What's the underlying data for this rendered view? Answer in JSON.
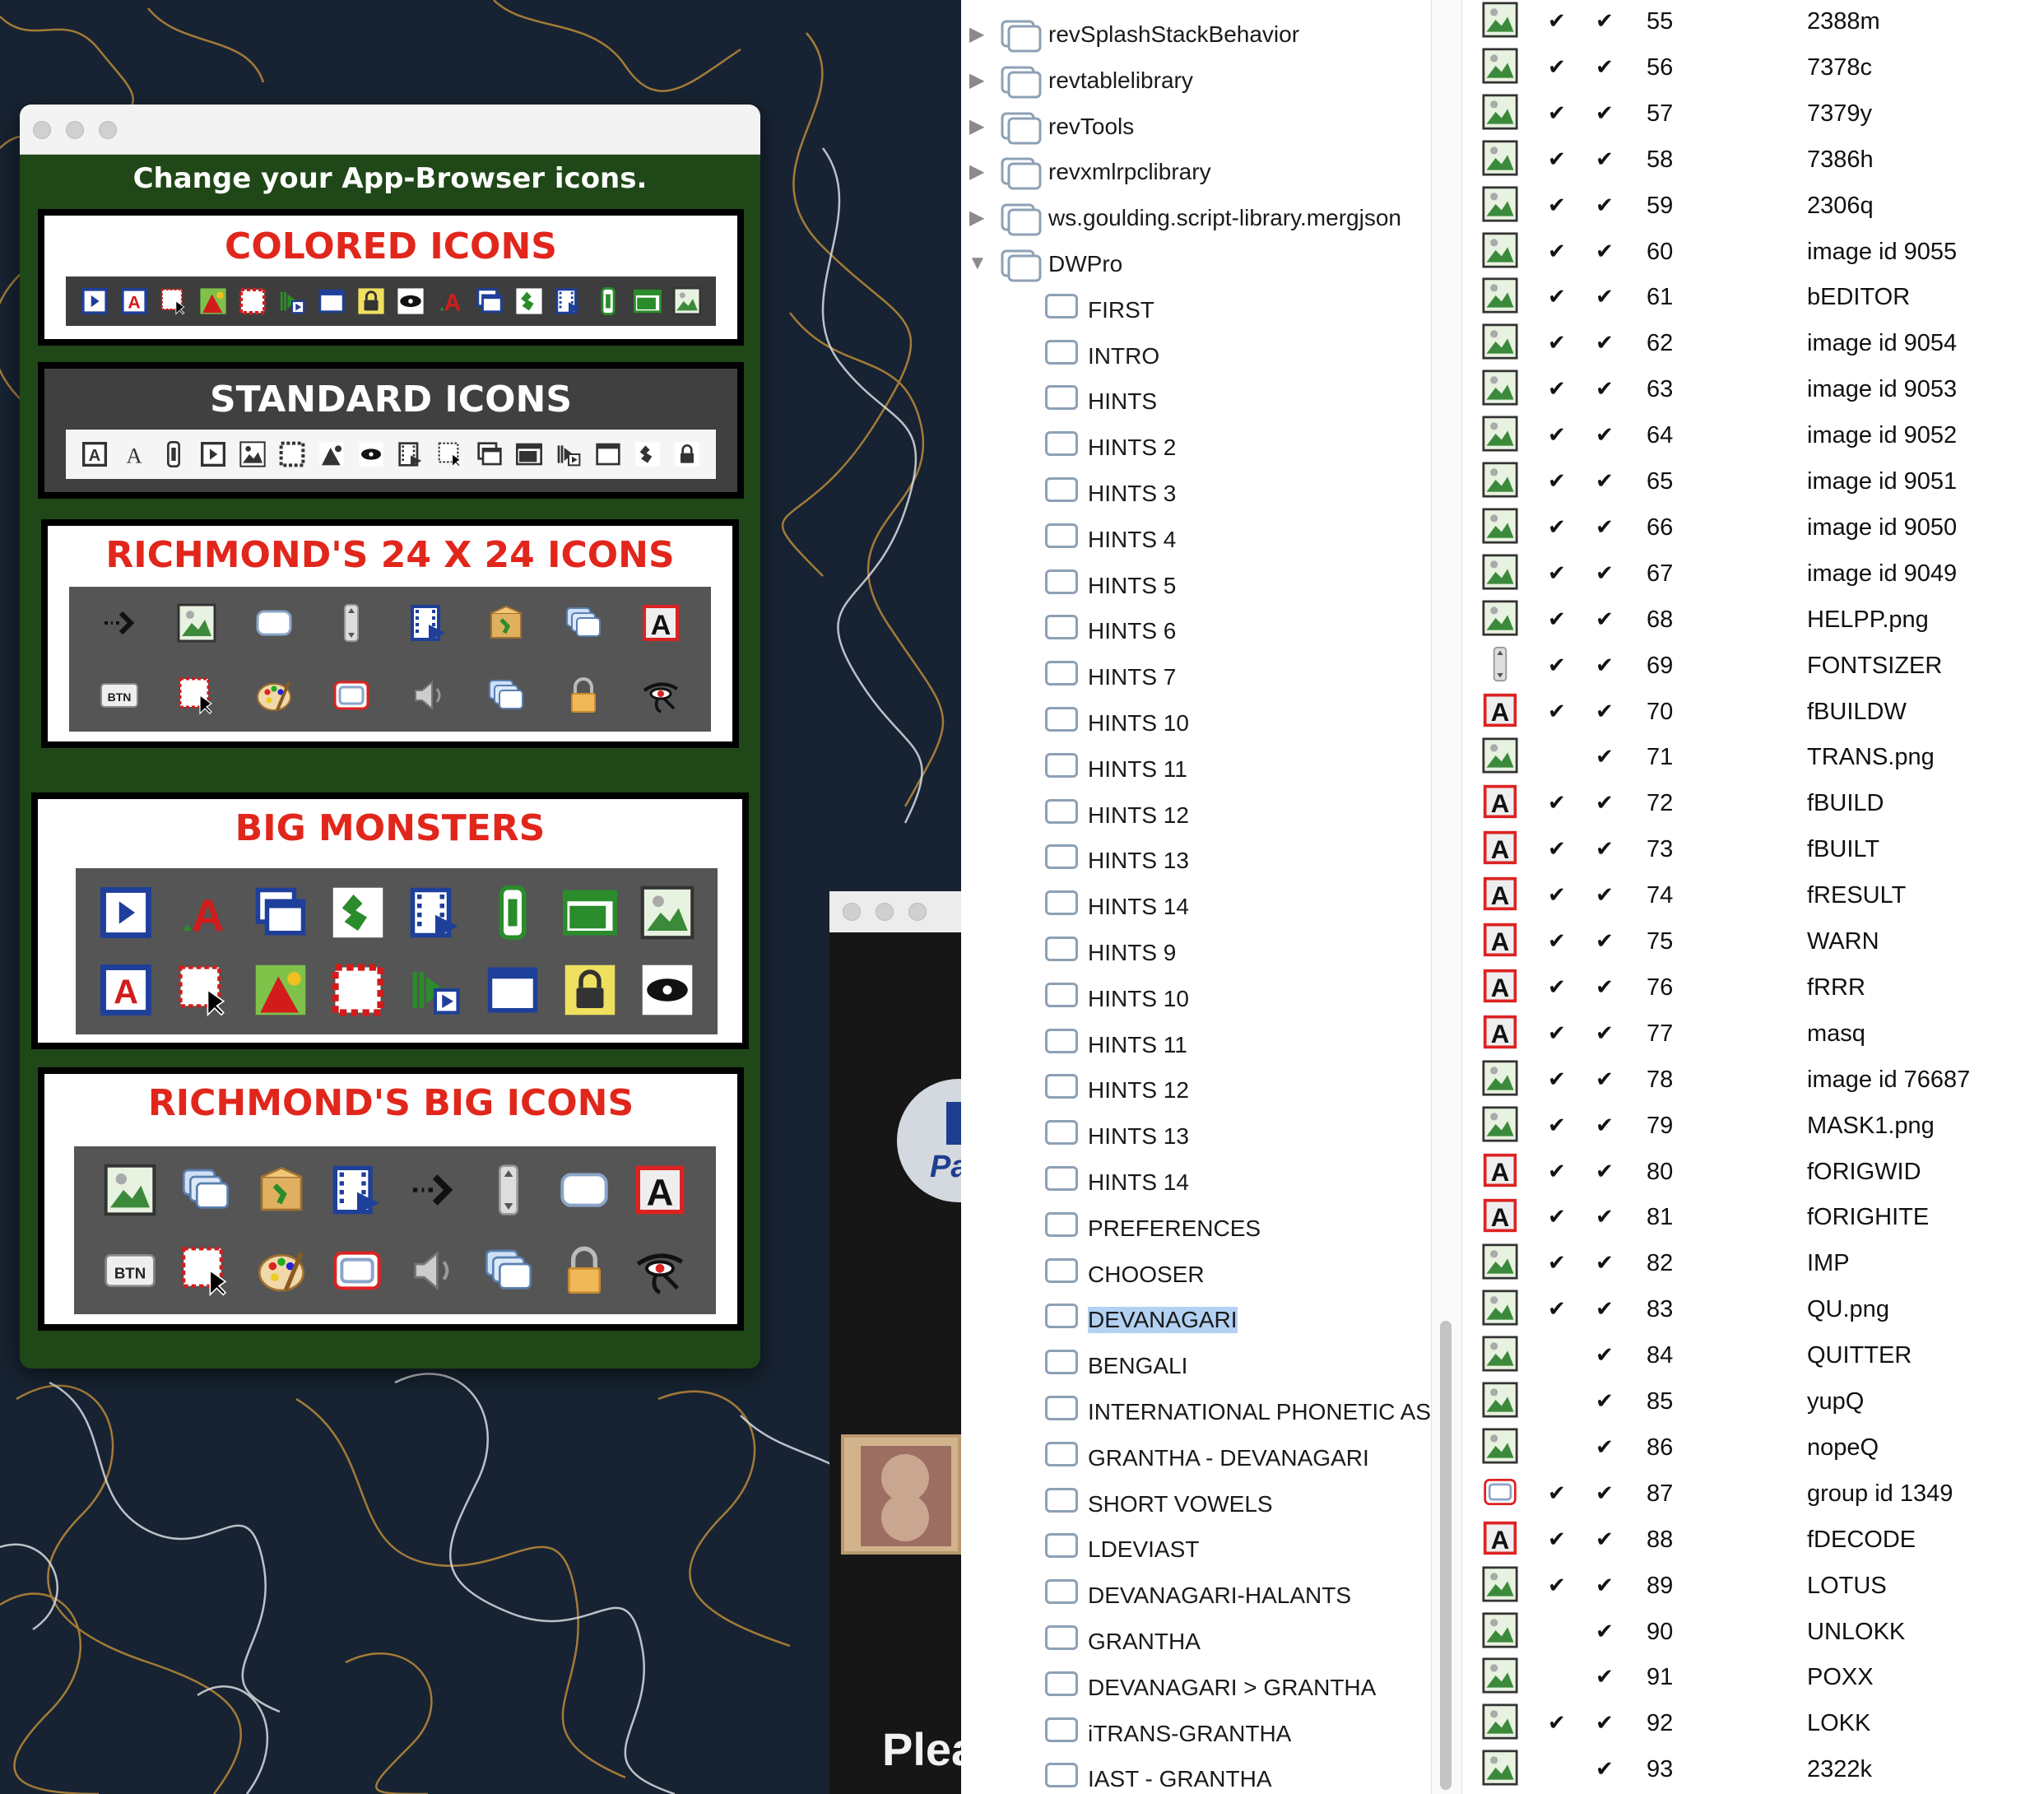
{
  "chooser": {
    "heading": "Change your App-Browser icons.",
    "sections": [
      {
        "title": "COLORED ICONS",
        "title_color": "#e1261c"
      },
      {
        "title": "STANDARD ICONS",
        "title_color": "#ffffff"
      },
      {
        "title": "RICHMOND'S 24 X 24 ICONS",
        "title_color": "#e1261c"
      },
      {
        "title": "BIG MONSTERS",
        "title_color": "#e1261c"
      },
      {
        "title": "RICHMOND'S BIG ICONS",
        "title_color": "#e1261c"
      }
    ],
    "colored_icons": [
      "player-icon",
      "field-icon",
      "selection-cursor-icon",
      "graphic-icon",
      "marquee-icon",
      "player-arrow-icon",
      "window-icon",
      "lock-icon",
      "eye-icon",
      "field-a-icon",
      "stack-icon",
      "puzzle-icon",
      "film-icon",
      "scrollbar-icon",
      "card-icon",
      "image-icon"
    ],
    "standard_icons": [
      "field-icon",
      "text-icon",
      "scrollbar-icon",
      "player-icon",
      "image-icon",
      "marquee-icon",
      "graphic-icon",
      "eye-icon",
      "film-icon",
      "selection-cursor-icon",
      "stack-icon",
      "card-icon",
      "player-arrow-icon",
      "window-icon",
      "puzzle-icon",
      "lock-icon"
    ],
    "richmond24_icons": [
      "arrow-dotted-icon",
      "image-icon",
      "button-icon",
      "scrollbar-icon",
      "film-icon",
      "package-icon",
      "stack-icon",
      "field-a-icon",
      "btn-icon",
      "selection-cursor-icon",
      "palette-icon",
      "group-icon",
      "speaker-icon",
      "stack-icon",
      "lock-icon",
      "eye-of-horus-icon"
    ],
    "monster_icons": [
      "player-icon",
      "field-a-icon",
      "stack-icon",
      "puzzle-icon",
      "film-icon",
      "scrollbar-icon",
      "card-icon",
      "image-icon",
      "field-icon",
      "selection-cursor-icon",
      "graphic-icon",
      "marquee-icon",
      "player-arrow-icon",
      "window-icon",
      "lock-icon",
      "eye-icon"
    ],
    "richmondbig_icons": [
      "image-icon",
      "stack-icon",
      "package-icon",
      "film-icon",
      "arrow-dotted-icon",
      "scrollbar-icon",
      "button-icon",
      "field-a-icon",
      "btn-icon",
      "selection-cursor-icon",
      "palette-icon",
      "group-icon",
      "speaker-icon",
      "stack-icon",
      "lock-icon",
      "eye-of-horus-icon"
    ],
    "btn_label": "BTN",
    "field_letter": "A"
  },
  "bg_window": {
    "text": "Plea",
    "logo_text": "Pa"
  },
  "tree": {
    "libraries": [
      "revSplashStackBehavior",
      "revtablelibrary",
      "revTools",
      "revxmlrpclibrary",
      "ws.goulding.script-library.mergjson"
    ],
    "expanded_stack": "DWPro",
    "cards": [
      "FIRST",
      "INTRO",
      "HINTS",
      "HINTS 2",
      "HINTS 3",
      "HINTS 4",
      "HINTS 5",
      "HINTS 6",
      "HINTS 7",
      "HINTS 10",
      "HINTS 11",
      "HINTS 12",
      "HINTS 13",
      "HINTS 14",
      "HINTS 9",
      "HINTS 10",
      "HINTS 11",
      "HINTS 12",
      "HINTS 13",
      "HINTS 14",
      "PREFERENCES",
      "CHOOSER",
      "DEVANAGARI",
      "BENGALI",
      "INTERNATIONAL PHONETIC AS",
      "GRANTHA - DEVANAGARI",
      "SHORT VOWELS",
      "LDEVIAST",
      "DEVANAGARI-HALANTS",
      "GRANTHA",
      "DEVANAGARI > GRANTHA",
      "iTRANS-GRANTHA",
      "IAST - GRANTHA"
    ],
    "selected_index": 22
  },
  "table": {
    "rows": [
      {
        "icon": "image-icon",
        "c1": true,
        "c2": true,
        "num": "55",
        "name": "2388m"
      },
      {
        "icon": "image-icon",
        "c1": true,
        "c2": true,
        "num": "56",
        "name": "7378c"
      },
      {
        "icon": "image-icon",
        "c1": true,
        "c2": true,
        "num": "57",
        "name": "7379y"
      },
      {
        "icon": "image-icon",
        "c1": true,
        "c2": true,
        "num": "58",
        "name": "7386h"
      },
      {
        "icon": "image-icon",
        "c1": true,
        "c2": true,
        "num": "59",
        "name": "2306q"
      },
      {
        "icon": "image-icon",
        "c1": true,
        "c2": true,
        "num": "60",
        "name": "image id 9055"
      },
      {
        "icon": "image-icon",
        "c1": true,
        "c2": true,
        "num": "61",
        "name": "bEDITOR"
      },
      {
        "icon": "image-icon",
        "c1": true,
        "c2": true,
        "num": "62",
        "name": "image id 9054"
      },
      {
        "icon": "image-icon",
        "c1": true,
        "c2": true,
        "num": "63",
        "name": "image id 9053"
      },
      {
        "icon": "image-icon",
        "c1": true,
        "c2": true,
        "num": "64",
        "name": "image id 9052"
      },
      {
        "icon": "image-icon",
        "c1": true,
        "c2": true,
        "num": "65",
        "name": "image id 9051"
      },
      {
        "icon": "image-icon",
        "c1": true,
        "c2": true,
        "num": "66",
        "name": "image id 9050"
      },
      {
        "icon": "image-icon",
        "c1": true,
        "c2": true,
        "num": "67",
        "name": "image id 9049"
      },
      {
        "icon": "image-icon",
        "c1": true,
        "c2": true,
        "num": "68",
        "name": "HELPP.png"
      },
      {
        "icon": "scrollbar-icon",
        "c1": true,
        "c2": true,
        "num": "69",
        "name": "FONTSIZER"
      },
      {
        "icon": "field-a-icon",
        "c1": true,
        "c2": true,
        "num": "70",
        "name": "fBUILDW"
      },
      {
        "icon": "image-icon",
        "c1": false,
        "c2": true,
        "num": "71",
        "name": "TRANS.png"
      },
      {
        "icon": "field-a-icon",
        "c1": true,
        "c2": true,
        "num": "72",
        "name": "fBUILD"
      },
      {
        "icon": "field-a-icon",
        "c1": true,
        "c2": true,
        "num": "73",
        "name": "fBUILT"
      },
      {
        "icon": "field-a-icon",
        "c1": true,
        "c2": true,
        "num": "74",
        "name": "fRESULT"
      },
      {
        "icon": "field-a-icon",
        "c1": true,
        "c2": true,
        "num": "75",
        "name": "WARN"
      },
      {
        "icon": "field-a-icon",
        "c1": true,
        "c2": true,
        "num": "76",
        "name": "fRRR"
      },
      {
        "icon": "field-a-icon",
        "c1": true,
        "c2": true,
        "num": "77",
        "name": "masq"
      },
      {
        "icon": "image-icon",
        "c1": true,
        "c2": true,
        "num": "78",
        "name": "image id 76687"
      },
      {
        "icon": "image-icon",
        "c1": true,
        "c2": true,
        "num": "79",
        "name": "MASK1.png"
      },
      {
        "icon": "field-a-icon",
        "c1": true,
        "c2": true,
        "num": "80",
        "name": "fORIGWID"
      },
      {
        "icon": "field-a-icon",
        "c1": true,
        "c2": true,
        "num": "81",
        "name": "fORIGHITE"
      },
      {
        "icon": "image-icon",
        "c1": true,
        "c2": true,
        "num": "82",
        "name": "IMP"
      },
      {
        "icon": "image-icon",
        "c1": true,
        "c2": true,
        "num": "83",
        "name": "QU.png"
      },
      {
        "icon": "image-icon",
        "c1": false,
        "c2": true,
        "num": "84",
        "name": "QUITTER"
      },
      {
        "icon": "image-icon",
        "c1": false,
        "c2": true,
        "num": "85",
        "name": "yupQ"
      },
      {
        "icon": "image-icon",
        "c1": false,
        "c2": true,
        "num": "86",
        "name": "nopeQ"
      },
      {
        "icon": "group-icon",
        "c1": true,
        "c2": true,
        "num": "87",
        "name": "group id 1349"
      },
      {
        "icon": "field-a-icon",
        "c1": true,
        "c2": true,
        "num": "88",
        "name": "fDECODE"
      },
      {
        "icon": "image-icon",
        "c1": true,
        "c2": true,
        "num": "89",
        "name": "LOTUS"
      },
      {
        "icon": "image-icon",
        "c1": false,
        "c2": true,
        "num": "90",
        "name": "UNLOKK"
      },
      {
        "icon": "image-icon",
        "c1": false,
        "c2": true,
        "num": "91",
        "name": "POXX"
      },
      {
        "icon": "image-icon",
        "c1": true,
        "c2": true,
        "num": "92",
        "name": "LOKK"
      },
      {
        "icon": "image-icon",
        "c1": false,
        "c2": true,
        "num": "93",
        "name": "2322k"
      }
    ],
    "check_glyph": "✔"
  },
  "colors": {
    "chooser_bg": "#1f4717",
    "accent_red": "#e1261c",
    "selection": "#b3d1f2",
    "desktop": "#172332"
  }
}
